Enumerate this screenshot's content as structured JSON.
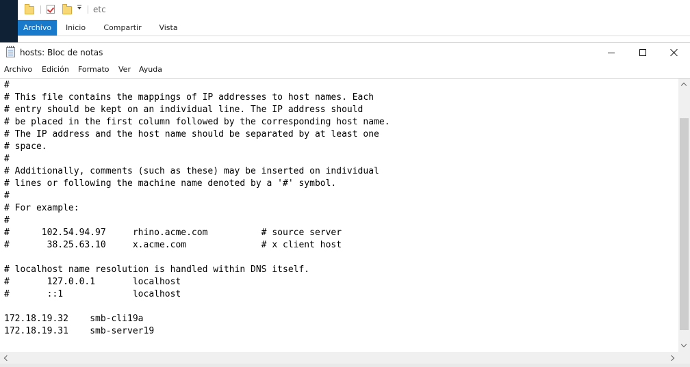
{
  "explorer": {
    "path": "etc",
    "tabs": [
      {
        "label": "Archivo",
        "active": true
      },
      {
        "label": "Inicio",
        "active": false
      },
      {
        "label": "Compartir",
        "active": false
      },
      {
        "label": "Vista",
        "active": false
      }
    ],
    "accent_color": "#1979ca"
  },
  "notepad": {
    "title": "hosts: Bloc de notas",
    "menu": [
      "Archivo",
      "Edición",
      "Formato",
      "Ver",
      "Ayuda"
    ],
    "window_controls": [
      "minimize",
      "maximize",
      "close"
    ],
    "content": "#\n# This file contains the mappings of IP addresses to host names. Each\n# entry should be kept on an individual line. The IP address should\n# be placed in the first column followed by the corresponding host name.\n# The IP address and the host name should be separated by at least one\n# space.\n#\n# Additionally, comments (such as these) may be inserted on individual\n# lines or following the machine name denoted by a '#' symbol.\n#\n# For example:\n#\n#      102.54.94.97     rhino.acme.com          # source server\n#       38.25.63.10     x.acme.com              # x client host\n\n# localhost name resolution is handled within DNS itself.\n#\t127.0.0.1       localhost\n#\t::1             localhost\n\n172.18.19.32    smb-cli19a\n172.18.19.31    smb-server19"
  },
  "icons": {
    "qat": [
      "folder-icon",
      "properties-check-icon",
      "new-folder-icon",
      "customize-dropdown-icon"
    ],
    "app": "notepad-icon"
  }
}
